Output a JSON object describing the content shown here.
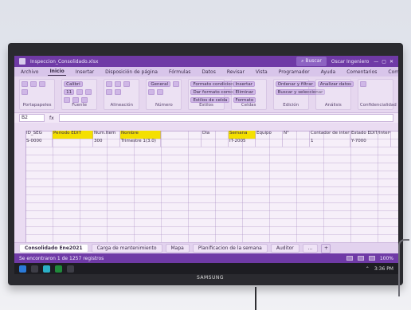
{
  "excel": {
    "titlebar": {
      "filename": "Inspeccion_Consolidado.xlsx",
      "search_placeholder": "Buscar",
      "user": "Oscar Ingeniero"
    },
    "menu": {
      "tabs": [
        "Archivo",
        "Inicio",
        "Insertar",
        "Disposición de página",
        "Fórmulas",
        "Datos",
        "Revisar",
        "Vista",
        "Programador",
        "Ayuda"
      ],
      "right": [
        "Comentarios",
        "Compartir"
      ]
    },
    "ribbon": {
      "groups": [
        {
          "name": "Portapapeles"
        },
        {
          "name": "Fuente"
        },
        {
          "name": "Alineación"
        },
        {
          "name": "Número"
        },
        {
          "name": "Estilos"
        },
        {
          "name": "Celdas"
        },
        {
          "name": "Edición"
        },
        {
          "name": "Análisis"
        },
        {
          "name": "Confidencialidad"
        }
      ],
      "font": "Calibri",
      "font_size": "11",
      "number_format": "General",
      "styles_items": [
        "Formato condicional",
        "Dar formato como tabla",
        "Estilos de celda"
      ],
      "cells_items": [
        "Insertar",
        "Eliminar",
        "Formato"
      ],
      "edit_items": [
        "Ordenar y filtrar",
        "Buscar y seleccionar"
      ],
      "analyze_items": [
        "Analizar datos"
      ]
    },
    "formula_bar": {
      "name_box": "B2",
      "fx_value": "fx"
    },
    "sheet": {
      "column_letters": [
        "A",
        "B",
        "C",
        "D",
        "E",
        "F",
        "G",
        "H",
        "I",
        "J",
        "K",
        "L",
        "M",
        "N"
      ],
      "header_row": [
        "ID_SEG",
        "Periodo EDIT",
        "Num.Item",
        "Nombre",
        "",
        "Dia",
        "Semana",
        "Equipo",
        "N°",
        "",
        "Contador de intervalos",
        "",
        "",
        "Estado EDIT/Intervalo"
      ],
      "first_row": [
        "S-0000",
        "",
        "300",
        "Trimestre 1(3.0)",
        "",
        "",
        "IT-2005",
        "",
        "",
        "",
        "1",
        "",
        "",
        "Y-7000"
      ]
    },
    "tabs": [
      "Consolidado Ene2021",
      "Carga de mantenimiento",
      "Mapa",
      "Planificacion de la semana",
      "Auditor",
      "..."
    ],
    "status": {
      "left": "Se encontraron 1 de 1257 registros",
      "zoom": "100%",
      "time": "3:36 PM"
    }
  }
}
